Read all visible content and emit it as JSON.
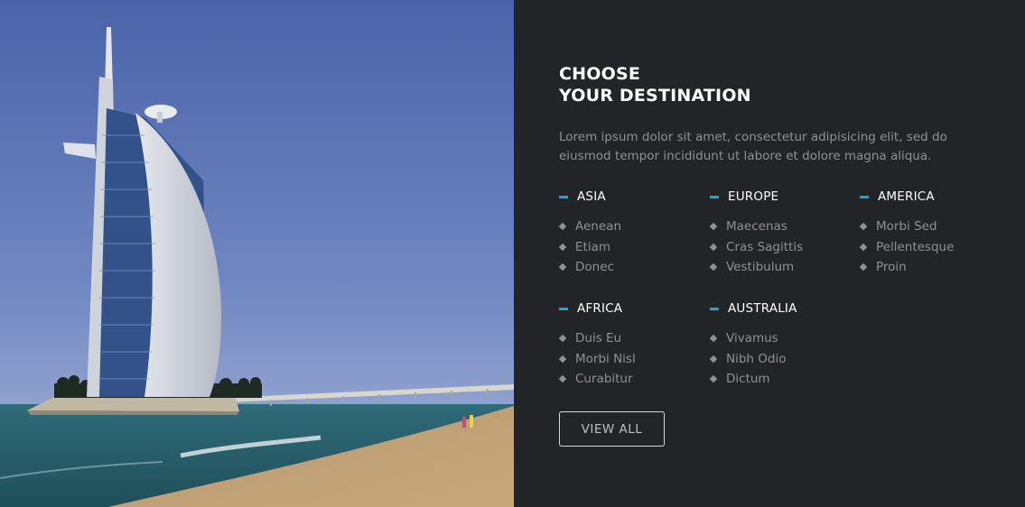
{
  "hero": {
    "title_line1": "CHOOSE",
    "title_line2": "YOUR DESTINATION",
    "description": "Lorem ipsum dolor sit amet, consectetur adipisicing elit, sed do eiusmod tempor incididunt ut labore et dolore magna aliqua."
  },
  "regions": [
    {
      "name": "ASIA",
      "items": [
        "Aenean",
        "Etiam",
        "Donec"
      ]
    },
    {
      "name": "EUROPE",
      "items": [
        "Maecenas",
        "Cras Sagittis",
        "Vestibulum"
      ]
    },
    {
      "name": "AMERICA",
      "items": [
        "Morbi Sed",
        "Pellentesque",
        "Proin"
      ]
    },
    {
      "name": "AFRICA",
      "items": [
        "Duis Eu",
        "Morbi Nisl",
        "Curabitur"
      ]
    },
    {
      "name": "AUSTRALIA",
      "items": [
        "Vivamus",
        "Nibh Odio",
        "Dictum"
      ]
    }
  ],
  "cta": {
    "label": "VIEW ALL"
  },
  "colors": {
    "panel_bg": "#232427",
    "accent": "#16a6e6",
    "muted_text": "#8f9196",
    "heading_text": "#ffffff"
  },
  "icons": {
    "region_marker": "dash-icon",
    "list_bullet": "diamond-icon"
  }
}
